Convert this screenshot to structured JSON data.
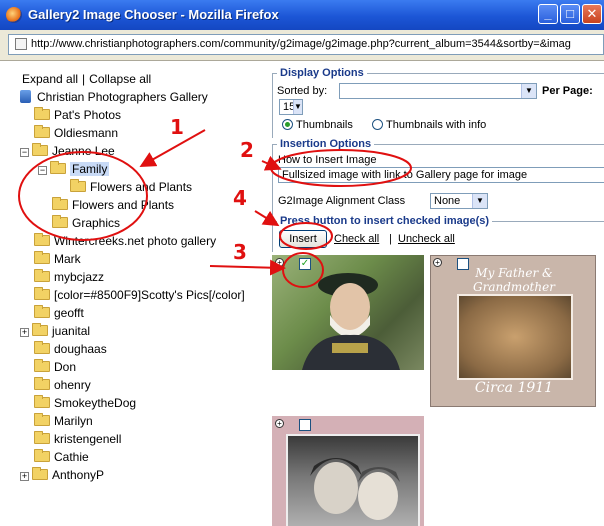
{
  "window": {
    "title": "Gallery2 Image Chooser - Mozilla Firefox"
  },
  "address": {
    "url": "http://www.christianphotographers.com/community/g2image/g2image.php?current_album=3544&sortby=&imag"
  },
  "tree": {
    "expand_all": "Expand all",
    "separator": "|",
    "collapse_all": "Collapse all",
    "root": "Christian Photographers Gallery",
    "items": [
      {
        "label": "Pat's Photos"
      },
      {
        "label": "Oldiesmann"
      },
      {
        "label": "Jeanne Lee"
      },
      {
        "label": "Family"
      },
      {
        "label": "Flowers and Plants"
      },
      {
        "label": "Flowers and Plants"
      },
      {
        "label": "Graphics"
      },
      {
        "label": "Wintercreeks.net photo gallery"
      },
      {
        "label": "Mark"
      },
      {
        "label": "mybcjazz"
      },
      {
        "label": "[color=#8500F9]Scotty's Pics[/color]"
      },
      {
        "label": "geofft"
      },
      {
        "label": "juanital"
      },
      {
        "label": "doughaas"
      },
      {
        "label": "Don"
      },
      {
        "label": "ohenry"
      },
      {
        "label": "SmokeytheDog"
      },
      {
        "label": "Marilyn"
      },
      {
        "label": "kristengenell"
      },
      {
        "label": "Cathie"
      },
      {
        "label": "AnthonyP"
      }
    ]
  },
  "display_options": {
    "legend": "Display Options",
    "sorted_by_label": "Sorted by:",
    "sorted_by_value": "",
    "per_page_label": "Per Page:",
    "per_page_value": "15",
    "thumbnails_label": "Thumbnails",
    "thumbnails_info_label": "Thumbnails with info"
  },
  "insertion_options": {
    "legend": "Insertion Options",
    "how_to_label": "How to Insert Image",
    "how_to_value": "Fullsized image with link to Gallery page for image",
    "alignment_label": "G2Image Alignment Class",
    "alignment_value": "None",
    "press_legend": "Press button to insert checked image(s)",
    "insert_button": "Insert",
    "check_all": "Check all",
    "separator": "|",
    "uncheck_all": "Uncheck all"
  },
  "thumbnails": [
    {
      "caption_top": "",
      "checked": true
    },
    {
      "caption_top": "My Father & Grandmother",
      "caption_bottom": "Circa 1911",
      "checked": false
    },
    {
      "checked": false
    }
  ],
  "annotations": [
    "1",
    "2",
    "3",
    "4"
  ],
  "colors": {
    "title_bar": "#1c56d6",
    "annotation": "#e01010",
    "legend": "#1a3a8a"
  }
}
